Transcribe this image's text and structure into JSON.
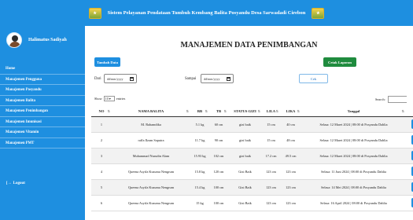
{
  "header": {
    "title": "Sistem Pelayanan Pendataan Tumbuh Kembang Balita Posyandu Desa Sarwadadi Cirebon",
    "logo_icon": "garuda-emblem-icon"
  },
  "sidebar": {
    "user_name": "Halimatus Sadiyah",
    "items": [
      {
        "label": "Home"
      },
      {
        "label": "Manajemen Pengguna"
      },
      {
        "label": "Manajemen Posyandu"
      },
      {
        "label": "Manajemen Balita"
      },
      {
        "label": "Manajemen Penimbangan"
      },
      {
        "label": "Manajemen Imunisasi"
      },
      {
        "label": "Manajemen Vitamin"
      },
      {
        "label": "Manajemen PMT"
      }
    ],
    "logout_label": "Logout",
    "bg_color": "#1e8fe0"
  },
  "main": {
    "title": "MANAJEMEN DATA PENIMBANGAN",
    "add_button": "Tambah Data",
    "print_button": "Cetak Laporan",
    "filter": {
      "from_label": "Dari",
      "to_label": "Sampai",
      "from_placeholder": "dd/mm/yyyy",
      "to_placeholder": "dd/mm/yyyy",
      "check_button": "Cek"
    },
    "show_label": "Show",
    "entries_value": "10",
    "entries_label": "entries",
    "search_label": "Search:"
  },
  "table": {
    "columns": [
      "NO",
      "NAMA BALITA",
      "BB",
      "TB",
      "STATUS GIZI",
      "LILA",
      "LIKA",
      "Tanggal",
      "A"
    ],
    "rows": [
      [
        "1",
        "M. Rahamdika",
        "5.1 kg",
        "60 cm",
        "gizi baik",
        "15 cm",
        "40 cm",
        "Selasa: 12 Maret 2024 | 08:00 di Posyandu Dahlia"
      ],
      [
        "2",
        "raffa Ilzam Saputra",
        "11.7 kg",
        "90 cm",
        "gizi baik",
        "15 cm",
        "48 cm",
        "Selasa: 12 Maret 2024 | 08:00 di Posyandu Dahlia"
      ],
      [
        "3",
        "Muhammad Nurudin Alam",
        "15.93 kg",
        "102 cm",
        "gizi baik",
        "17.2 cm",
        "49.5 cm",
        "Selasa: 12 Maret 2024 | 08:00 di Posyandu Dahlia"
      ],
      [
        "4",
        "Queena Asyifa Kusuma Nengrum",
        "15.8 kg",
        "120 cm",
        "Gizi Baik",
        "123 cm",
        "123 cm",
        "Selasa: 11 Juni 2024 | 08:00 di Posyandu Dahlia"
      ],
      [
        "5",
        "Queena Asyifa Kusuma Nengrum",
        "15.4 kg",
        "100 cm",
        "Gizi Baik",
        "123 cm",
        "123 cm",
        "Selasa: 14 Mei 2024 | 08:00 di Posyandu Dahlia"
      ],
      [
        "6",
        "Queena Asyifa Kusuma Nengrum",
        "15 kg",
        "100 cm",
        "Gizi Baik",
        "123 cm",
        "123 cm",
        "Selasa: 16 April 2024 | 08:00 di Posyandu Dahlia"
      ]
    ]
  }
}
